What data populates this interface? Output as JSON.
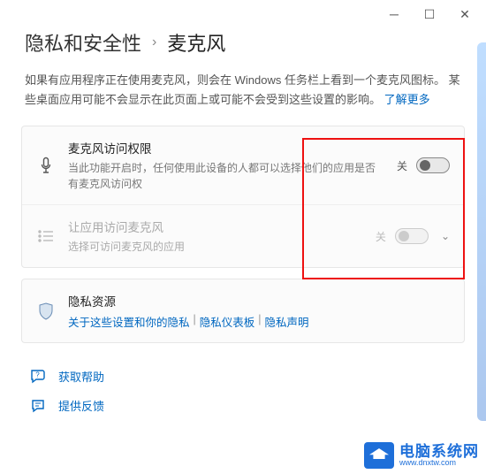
{
  "titlebar": {
    "min": "─",
    "max": "☐",
    "close": "✕"
  },
  "header": {
    "section": "隐私和安全性",
    "sep": "›",
    "current": "麦克风"
  },
  "desc": {
    "text": "如果有应用程序正在使用麦克风，则会在 Windows 任务栏上看到一个麦克风图标。 某些桌面应用可能不会显示在此页面上或可能不会受到这些设置的影响。 ",
    "link": "了解更多"
  },
  "row1": {
    "title": "麦克风访问权限",
    "sub": "当此功能开启时，任何使用此设备的人都可以选择他们的应用是否有麦克风访问权",
    "state": "关"
  },
  "row2": {
    "title": "让应用访问麦克风",
    "sub": "选择可访问麦克风的应用",
    "state": "关"
  },
  "row3": {
    "title": "隐私资源",
    "l1": "关于这些设置和你的隐私",
    "l2": "隐私仪表板",
    "l3": "隐私声明",
    "sep": "|"
  },
  "footer": {
    "help": "获取帮助",
    "feedback": "提供反馈"
  },
  "wm": {
    "t1": "电脑系统网",
    "t2": "www.dnxtw.com"
  }
}
